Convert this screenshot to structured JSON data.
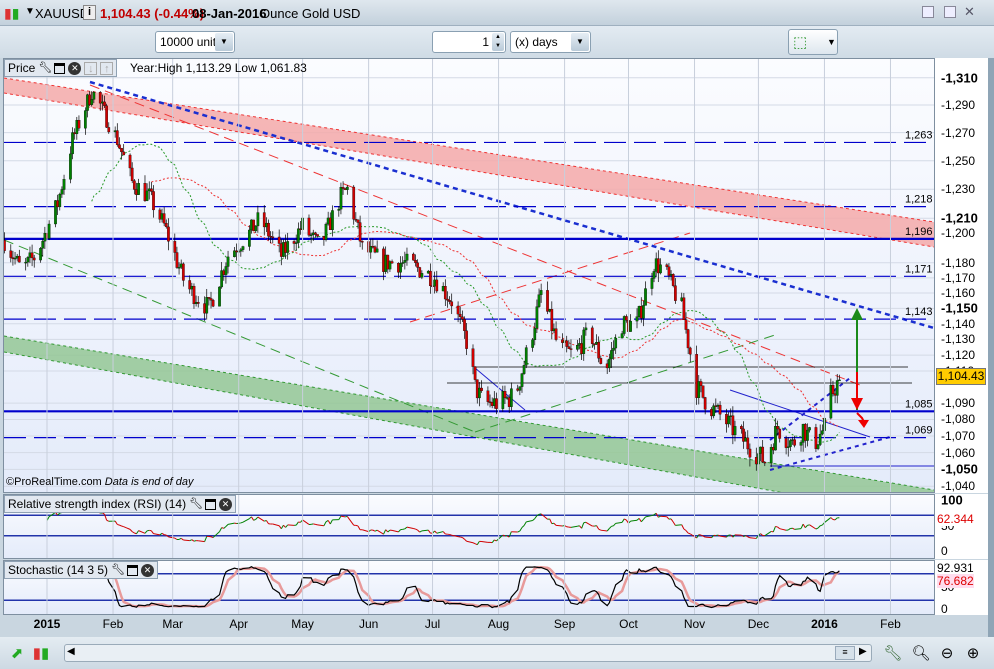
{
  "header": {
    "symbol": "XAUUSD",
    "price_change": "1,104.43 (-0.44%)",
    "date": "08-Jan-2016",
    "description": "Ounce Gold USD"
  },
  "toolbar": {
    "units": "10000 units",
    "period_value": "1",
    "period_unit": "(x) days"
  },
  "price_panel": {
    "title": "Price",
    "stats": "Year:High 1,113.29 Low 1,061.83",
    "watermark": "©ProRealTime.com",
    "watermark_note": "Data is end of day",
    "current_price": "1,104.43",
    "axis_ticks": [
      {
        "v": 1310,
        "t": "1,310",
        "b": true
      },
      {
        "v": 1290,
        "t": "1,290"
      },
      {
        "v": 1270,
        "t": "1,270"
      },
      {
        "v": 1250,
        "t": "1,250"
      },
      {
        "v": 1230,
        "t": "1,230"
      },
      {
        "v": 1210,
        "t": "1,210",
        "b": true
      },
      {
        "v": 1200,
        "t": "1,200"
      },
      {
        "v": 1180,
        "t": "1,180"
      },
      {
        "v": 1170,
        "t": "1,170"
      },
      {
        "v": 1160,
        "t": "1,160"
      },
      {
        "v": 1150,
        "t": "1,150",
        "b": true
      },
      {
        "v": 1140,
        "t": "1,140"
      },
      {
        "v": 1130,
        "t": "1,130"
      },
      {
        "v": 1120,
        "t": "1,120"
      },
      {
        "v": 1110,
        "t": "1,110"
      },
      {
        "v": 1090,
        "t": "1,090"
      },
      {
        "v": 1080,
        "t": "1,080"
      },
      {
        "v": 1070,
        "t": "1,070"
      },
      {
        "v": 1060,
        "t": "1,060"
      },
      {
        "v": 1050,
        "t": "1,050",
        "b": true
      },
      {
        "v": 1040,
        "t": "1,040"
      }
    ],
    "levels": [
      {
        "v": 1263,
        "t": "1,263",
        "style": "dash"
      },
      {
        "v": 1218,
        "t": "1,218",
        "style": "dash"
      },
      {
        "v": 1196,
        "t": "1,196",
        "style": "solid"
      },
      {
        "v": 1171,
        "t": "1,171",
        "style": "dash"
      },
      {
        "v": 1143,
        "t": "1,143",
        "style": "dash"
      },
      {
        "v": 1085,
        "t": "1,085",
        "style": "solid"
      },
      {
        "v": 1069,
        "t": "1,069",
        "style": "dash"
      }
    ]
  },
  "rsi_panel": {
    "title": "Relative strength index (RSI) (14)",
    "value": "62.344",
    "ticks": [
      {
        "v": 100,
        "t": "100"
      },
      {
        "v": 50,
        "t": "50"
      },
      {
        "v": 0,
        "t": "0"
      }
    ]
  },
  "stoch_panel": {
    "title": "Stochastic (14 3 5)",
    "k_value": "92.931",
    "d_value": "76.682",
    "ticks": [
      {
        "v": 50,
        "t": "50"
      },
      {
        "v": 0,
        "t": "0"
      }
    ]
  },
  "x_axis": [
    {
      "t": "2015",
      "d": 0,
      "b": true
    },
    {
      "t": "Feb",
      "d": 31
    },
    {
      "t": "Mar",
      "d": 59
    },
    {
      "t": "Apr",
      "d": 90
    },
    {
      "t": "May",
      "d": 120
    },
    {
      "t": "Jun",
      "d": 151
    },
    {
      "t": "Jul",
      "d": 181
    },
    {
      "t": "Aug",
      "d": 212
    },
    {
      "t": "Sep",
      "d": 243
    },
    {
      "t": "Oct",
      "d": 273
    },
    {
      "t": "Nov",
      "d": 304
    },
    {
      "t": "Dec",
      "d": 334
    },
    {
      "t": "2016",
      "d": 365,
      "b": true
    },
    {
      "t": "Feb",
      "d": 396
    }
  ],
  "colors": {
    "up": "#008000",
    "down": "#d00000",
    "level": "#0000cc",
    "price_tag": "#ffcc00",
    "change": "#c00000"
  },
  "chart_data": {
    "type": "candlestick",
    "title": "XAUUSD daily",
    "x_unit": "days since 2015-01-01",
    "y_scale": "log",
    "ylim": [
      1035,
      1318
    ],
    "close_path": [
      [
        -20,
        1195
      ],
      [
        -12,
        1175
      ],
      [
        -5,
        1185
      ],
      [
        5,
        1220
      ],
      [
        12,
        1265
      ],
      [
        21,
        1300
      ],
      [
        25,
        1290
      ],
      [
        33,
        1265
      ],
      [
        40,
        1235
      ],
      [
        48,
        1225
      ],
      [
        55,
        1205
      ],
      [
        65,
        1165
      ],
      [
        76,
        1150
      ],
      [
        85,
        1185
      ],
      [
        95,
        1200
      ],
      [
        100,
        1210
      ],
      [
        110,
        1185
      ],
      [
        120,
        1205
      ],
      [
        128,
        1190
      ],
      [
        138,
        1225
      ],
      [
        141,
        1230
      ],
      [
        148,
        1190
      ],
      [
        158,
        1180
      ],
      [
        168,
        1180
      ],
      [
        176,
        1175
      ],
      [
        182,
        1170
      ],
      [
        190,
        1155
      ],
      [
        198,
        1125
      ],
      [
        201,
        1100
      ],
      [
        205,
        1090
      ],
      [
        212,
        1090
      ],
      [
        220,
        1095
      ],
      [
        228,
        1135
      ],
      [
        232,
        1160
      ],
      [
        240,
        1125
      ],
      [
        247,
        1120
      ],
      [
        255,
        1135
      ],
      [
        262,
        1110
      ],
      [
        270,
        1140
      ],
      [
        277,
        1140
      ],
      [
        285,
        1180
      ],
      [
        290,
        1175
      ],
      [
        298,
        1150
      ],
      [
        305,
        1100
      ],
      [
        310,
        1090
      ],
      [
        318,
        1080
      ],
      [
        325,
        1070
      ],
      [
        333,
        1060
      ],
      [
        337,
        1055
      ],
      [
        343,
        1075
      ],
      [
        350,
        1065
      ],
      [
        355,
        1075
      ],
      [
        360,
        1065
      ],
      [
        365,
        1075
      ],
      [
        368,
        1095
      ],
      [
        372,
        1104.43
      ]
    ]
  }
}
